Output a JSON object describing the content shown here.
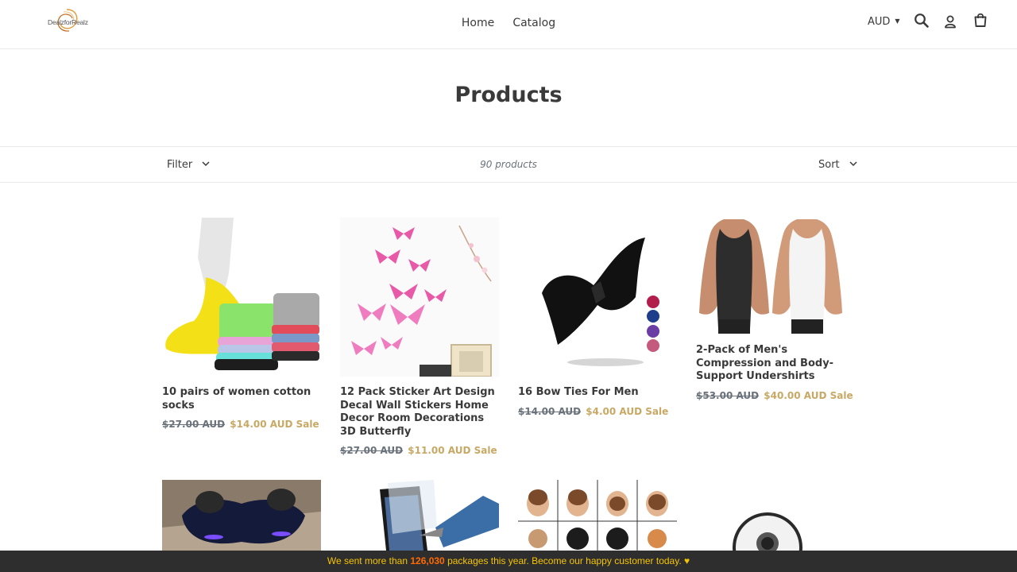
{
  "header": {
    "logo_text": "DealzforRealz",
    "nav": [
      "Home",
      "Catalog"
    ],
    "currency": "AUD",
    "icons": {
      "search": "search-icon",
      "account": "account-icon",
      "cart": "cart-icon"
    }
  },
  "page_title": "Products",
  "toolbar": {
    "filter_label": "Filter",
    "product_count": "90 products",
    "sort_label": "Sort"
  },
  "products": [
    {
      "name": "10 pairs of women cotton socks",
      "old_price": "$27.00 AUD",
      "new_price": "$14.00 AUD",
      "badge": "Sale"
    },
    {
      "name": "12 Pack Sticker Art Design Decal Wall Stickers Home Decor Room Decorations 3D Butterfly",
      "old_price": "$27.00 AUD",
      "new_price": "$11.00 AUD",
      "badge": "Sale"
    },
    {
      "name": "16 Bow Ties For Men",
      "old_price": "$14.00 AUD",
      "new_price": "$4.00 AUD",
      "badge": "Sale"
    },
    {
      "name": "2-Pack of Men's Compression and Body-Support Undershirts",
      "old_price": "$53.00 AUD",
      "new_price": "$40.00 AUD",
      "badge": "Sale"
    }
  ],
  "banner": {
    "prefix": "We sent more than ",
    "number": "126,030",
    "suffix": " packages this year. Become our happy customer today. ♥"
  },
  "colors": {
    "sale": "#c8a865",
    "banner_bg": "#2e2e2e",
    "banner_text": "#f5c400",
    "banner_highlight": "#ff6a00"
  }
}
